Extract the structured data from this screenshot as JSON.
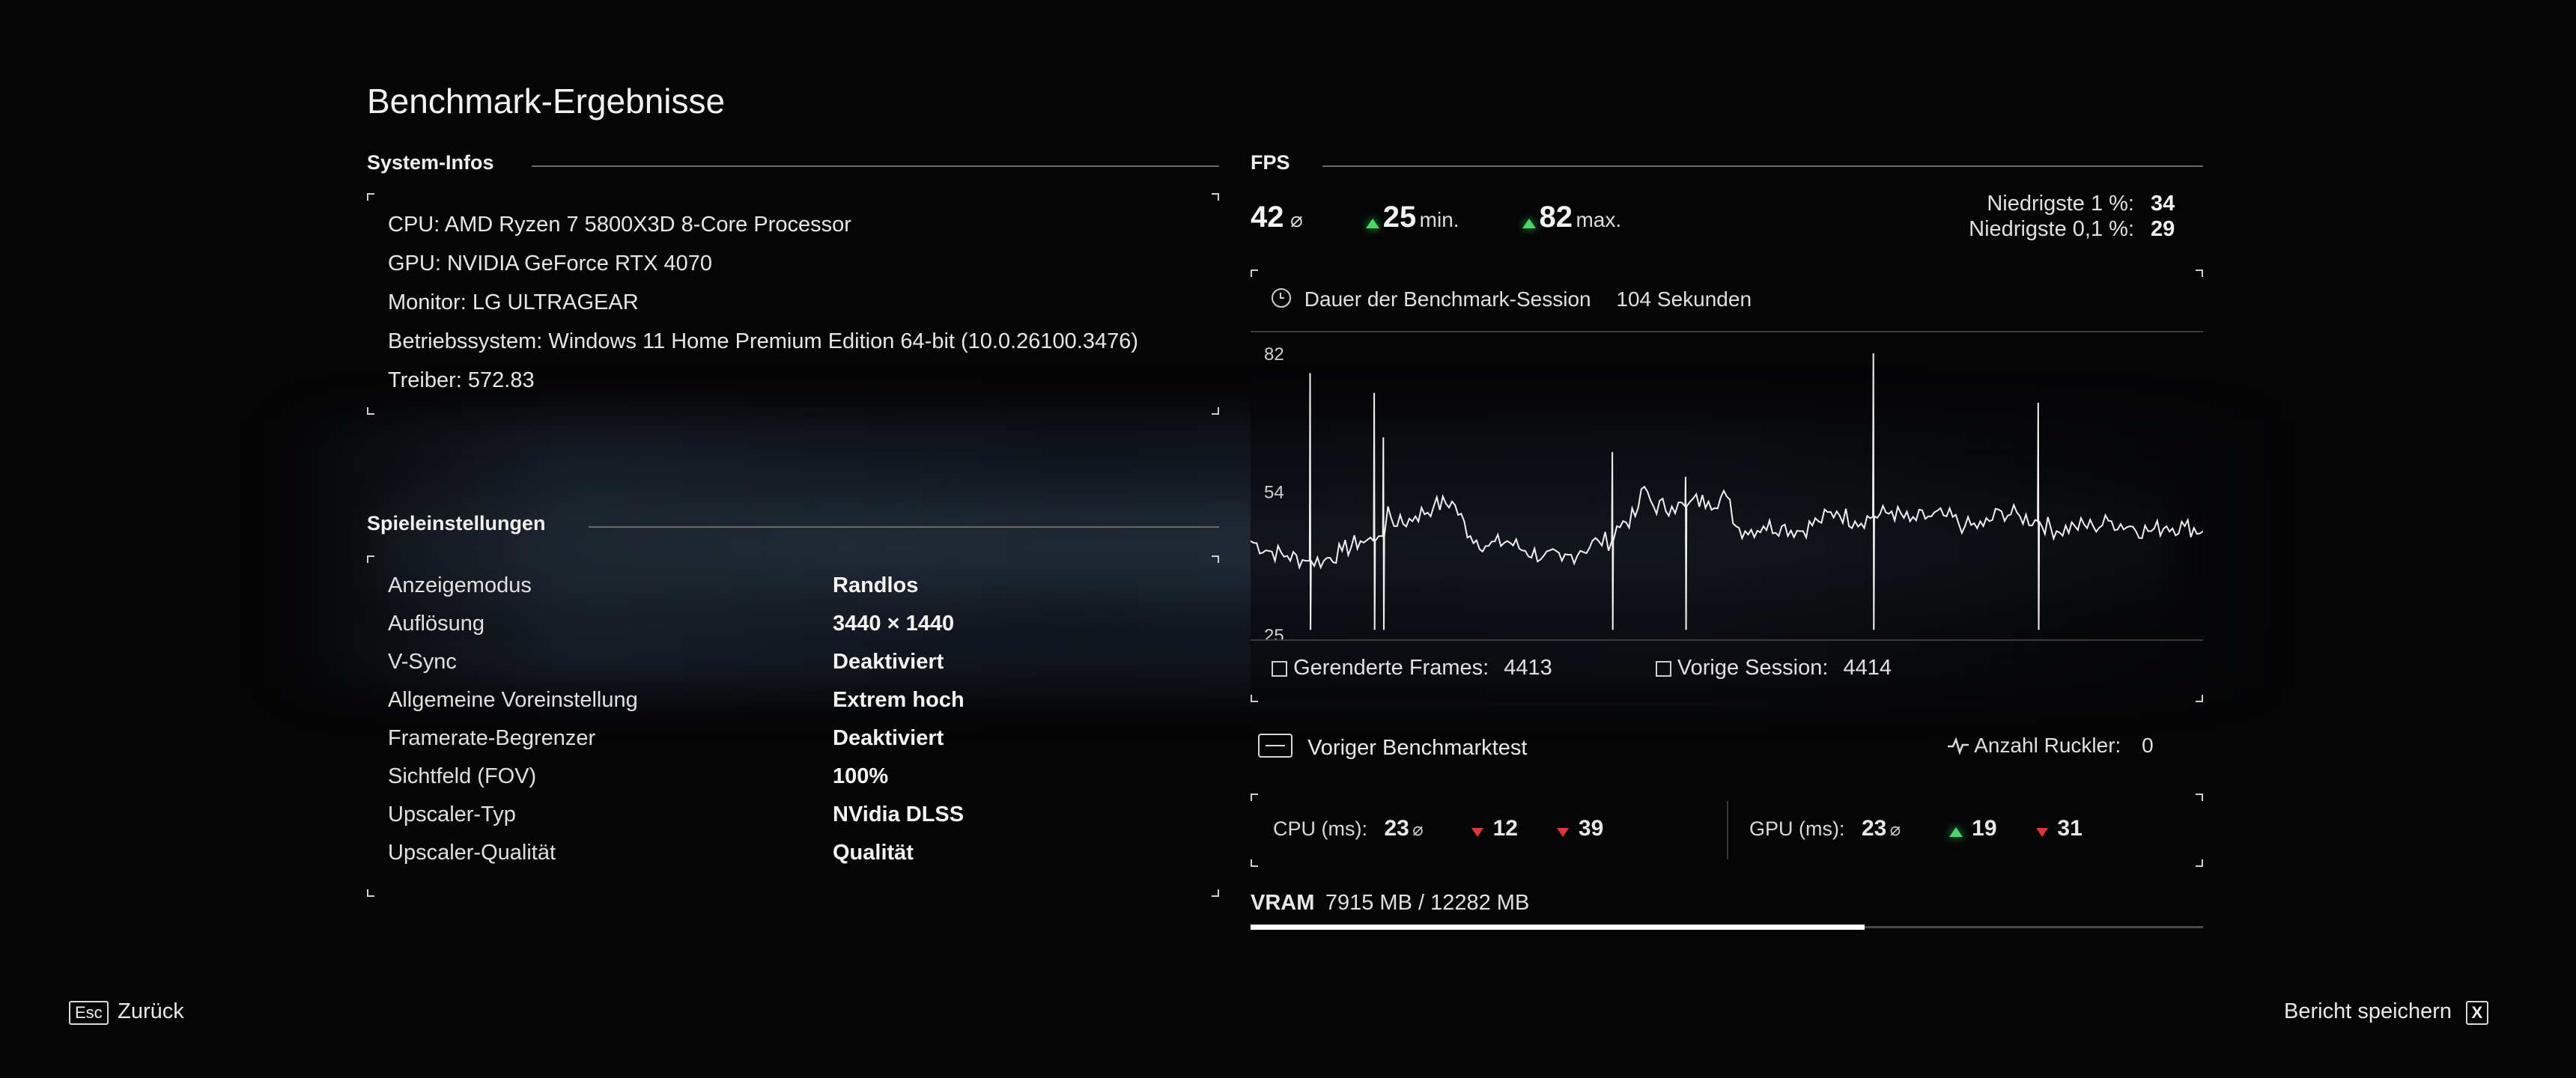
{
  "page": {
    "title": "Benchmark-Ergebnisse"
  },
  "system": {
    "heading": "System-Infos",
    "lines": [
      "CPU: AMD Ryzen 7 5800X3D 8-Core Processor",
      "GPU: NVIDIA GeForce RTX 4070",
      "Monitor: LG ULTRAGEAR",
      "Betriebssystem: Windows 11 Home Premium Edition 64-bit (10.0.26100.3476)",
      "Treiber: 572.83"
    ]
  },
  "settings": {
    "heading": "Spieleinstellungen",
    "rows": [
      {
        "label": "Anzeigemodus",
        "value": "Randlos"
      },
      {
        "label": "Auflösung",
        "value": "3440 × 1440"
      },
      {
        "label": "V-Sync",
        "value": "Deaktiviert"
      },
      {
        "label": "Allgemeine Voreinstellung",
        "value": "Extrem hoch"
      },
      {
        "label": "Framerate-Begrenzer",
        "value": "Deaktiviert"
      },
      {
        "label": "Sichtfeld (FOV)",
        "value": "100%"
      },
      {
        "label": "Upscaler-Typ",
        "value": "NVidia DLSS"
      },
      {
        "label": "Upscaler-Qualität",
        "value": "Qualität"
      }
    ]
  },
  "fps": {
    "heading": "FPS",
    "avg": "42",
    "avg_symbol": "⌀",
    "min": "25",
    "min_label": "min.",
    "max": "82",
    "max_label": "max.",
    "low1_label": "Niedrigste 1 %:",
    "low1_value": "34",
    "low01_label": "Niedrigste 0,1 %:",
    "low01_value": "29",
    "session_label": "Dauer der Benchmark-Session",
    "session_value": "104 Sekunden",
    "rendered_label": "Gerenderte Frames:",
    "rendered_value": "4413",
    "prev_session_label": "Vorige Session:",
    "prev_session_value": "4414",
    "prev_benchmark_label": "Voriger Benchmarktest",
    "stutter_label": "Anzahl Ruckler:",
    "stutter_value": "0"
  },
  "chart_data": {
    "type": "line",
    "title": "",
    "ylim": [
      25,
      82
    ],
    "yticks": [
      "82",
      "54",
      "25"
    ],
    "x": [
      0,
      2,
      4,
      6,
      8,
      10,
      12,
      14,
      15,
      16,
      18,
      20,
      22,
      24,
      26,
      28,
      30,
      32,
      34,
      36,
      38,
      40,
      42,
      43,
      44,
      46,
      48,
      50,
      52,
      53,
      54,
      56,
      58,
      60,
      62,
      64,
      66,
      68,
      70,
      72,
      74,
      76,
      78,
      80,
      82,
      84,
      86,
      88,
      90,
      92,
      94,
      96,
      98,
      100,
      102,
      104
    ],
    "values": [
      44,
      42,
      41,
      40,
      40,
      42,
      44,
      45,
      51,
      47,
      49,
      51,
      52,
      45,
      43,
      44,
      42,
      41,
      40,
      42,
      44,
      47,
      49,
      55,
      51,
      51,
      52,
      52,
      53,
      47,
      46,
      47,
      47,
      46,
      48,
      50,
      48,
      49,
      50,
      48,
      49,
      49,
      47,
      47,
      50,
      49,
      48,
      46,
      47,
      47,
      48,
      47,
      46,
      47,
      47,
      46
    ],
    "spikes": [
      {
        "x": 6.5,
        "y": 78
      },
      {
        "x": 13.5,
        "y": 74
      },
      {
        "x": 14.5,
        "y": 65
      },
      {
        "x": 39.5,
        "y": 62
      },
      {
        "x": 47.5,
        "y": 57
      },
      {
        "x": 68,
        "y": 82
      },
      {
        "x": 86,
        "y": 72
      }
    ]
  },
  "cpu": {
    "label": "CPU (ms):",
    "avg": "23",
    "avg_symbol": "⌀",
    "a": "12",
    "b": "39"
  },
  "gpu": {
    "label": "GPU (ms):",
    "avg": "23",
    "avg_symbol": "⌀",
    "a": "19",
    "b": "31"
  },
  "vram": {
    "label": "VRAM",
    "value": "7915 MB / 12282 MB",
    "used": 7915,
    "total": 12282
  },
  "footer": {
    "back_key": "Esc",
    "back_label": "Zurück",
    "save_label": "Bericht speichern",
    "save_key": "X"
  },
  "colors": {
    "up": "#45d96b",
    "down": "#e03636",
    "accent": "#ffffff"
  }
}
